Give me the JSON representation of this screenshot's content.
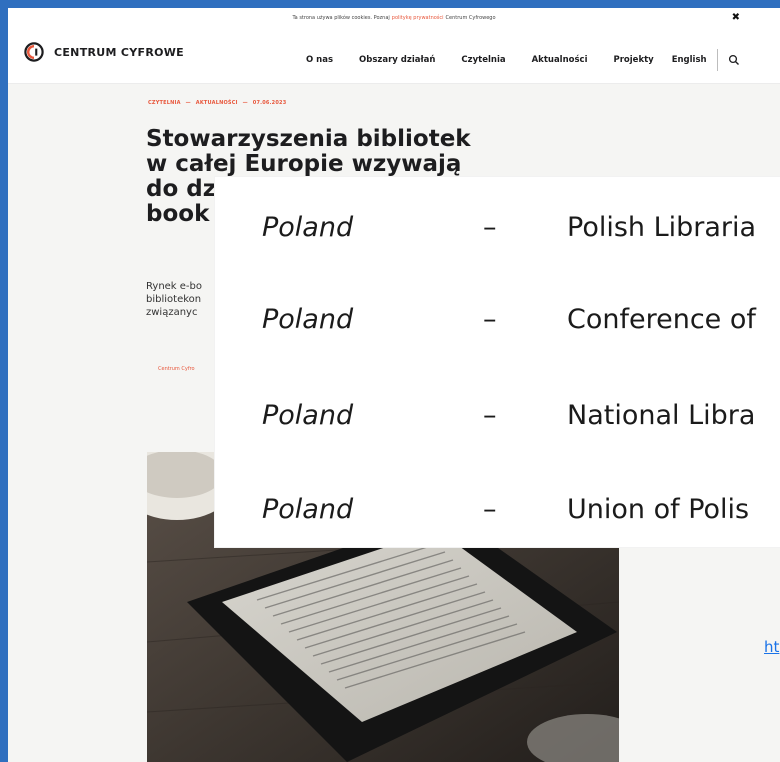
{
  "cookie": {
    "text_before": "Ta strona używa plików cookies. Poznaj",
    "link": "politykę prywatności",
    "text_after": "Centrum Cyfrowego",
    "close_glyph": "✖"
  },
  "header": {
    "logo_text": "CENTRUM CYFROWE",
    "nav": [
      "O nas",
      "Obszary działań",
      "Czytelnia",
      "Aktualności",
      "Projekty",
      "English"
    ],
    "search_icon": "search-icon"
  },
  "article": {
    "crumbs": [
      "CZYTELNIA",
      "AKTUALNOŚCI",
      "07.06.2023"
    ],
    "crumb_sep": "—",
    "title_lines": [
      "Stowarzyszenia bibliotek",
      "w ca",
      "do dz",
      "book"
    ],
    "title_visible_tail": "łej Europie wzywają",
    "lead_lines": [
      "Rynek e-bo",
      "bibliotekon",
      "związanyc"
    ],
    "author": "Centrum Cyfro"
  },
  "overlay": {
    "rows": [
      {
        "country": "Poland",
        "dash": "–",
        "org": "Polish Libraria"
      },
      {
        "country": "Poland",
        "dash": "–",
        "org": "Conference of"
      },
      {
        "country": "Poland",
        "dash": "–",
        "org": "National Libra"
      },
      {
        "country": "Poland",
        "dash": "–",
        "org": "Union of Polis"
      }
    ]
  },
  "link_stub": "ht",
  "colors": {
    "accent": "#e8573c",
    "frame_blue": "#2f6fbf",
    "page_bg": "#f5f5f3",
    "text": "#1d1d1f",
    "link": "#1a73e8"
  }
}
